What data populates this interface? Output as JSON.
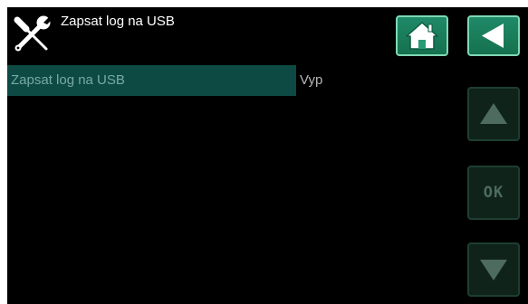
{
  "header": {
    "title": "Zapsat log na USB",
    "icon": "tools-icon"
  },
  "nav": {
    "home_icon": "home-icon",
    "back_icon": "back-arrow-icon",
    "up_icon": "arrow-up-icon",
    "down_icon": "arrow-down-icon",
    "ok_label": "OK"
  },
  "menu": {
    "items": [
      {
        "label": "Zapsat log na USB",
        "value": "Vyp",
        "selected": true
      }
    ]
  },
  "colors": {
    "background": "#000000",
    "accent": "#1f8a68",
    "selected_row": "#0d4a44",
    "disabled_button": "#10231b"
  }
}
